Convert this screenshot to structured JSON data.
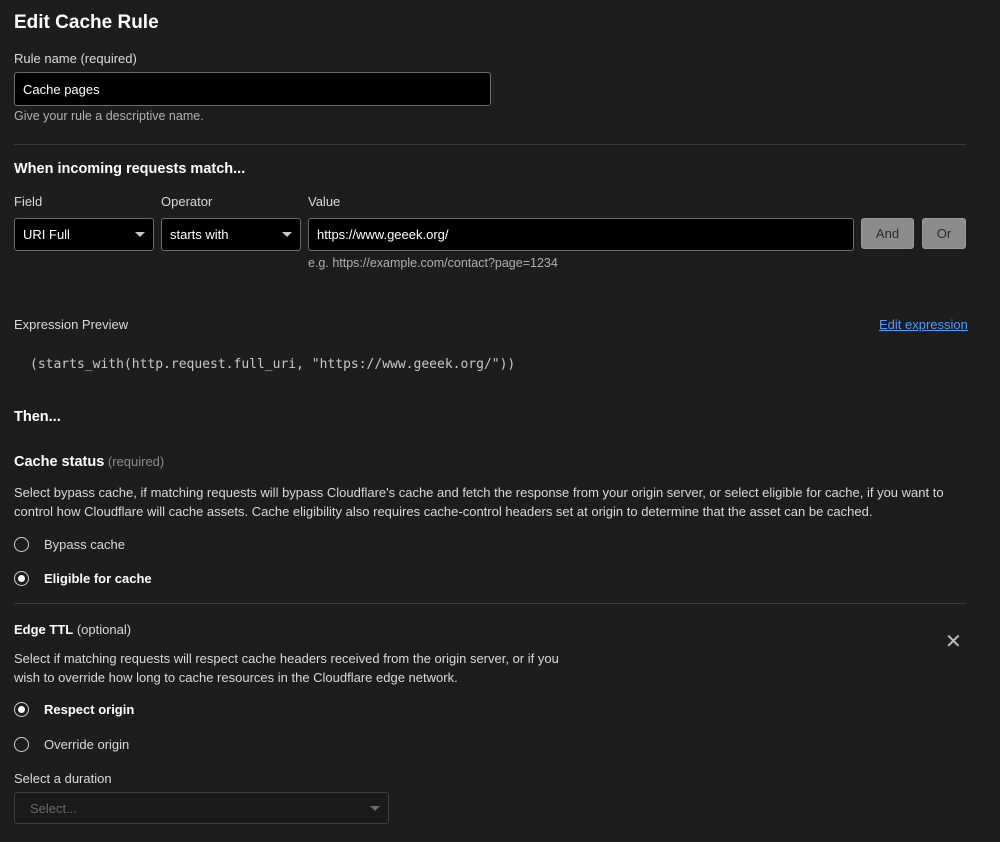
{
  "page": {
    "title": "Edit Cache Rule"
  },
  "rule_name": {
    "label": "Rule name (required)",
    "value": "Cache pages",
    "help": "Give your rule a descriptive name."
  },
  "match": {
    "heading": "When incoming requests match...",
    "field_label": "Field",
    "field_value": "URI Full",
    "operator_label": "Operator",
    "operator_value": "starts with",
    "value_label": "Value",
    "value_value": "https://www.geeek.org/",
    "value_example": "e.g. https://example.com/contact?page=1234",
    "and_label": "And",
    "or_label": "Or"
  },
  "expression": {
    "label": "Expression Preview",
    "edit_link": "Edit expression",
    "code": "(starts_with(http.request.full_uri, \"https://www.geeek.org/\"))"
  },
  "then": {
    "heading": "Then..."
  },
  "cache_status": {
    "heading": "Cache status",
    "required": "(required)",
    "description": "Select bypass cache, if matching requests will bypass Cloudflare's cache and fetch the response from your origin server, or select eligible for cache, if you want to control how Cloudflare will cache assets. Cache eligibility also requires cache-control headers set at origin to determine that the asset can be cached.",
    "options": [
      {
        "label": "Bypass cache",
        "selected": false
      },
      {
        "label": "Eligible for cache",
        "selected": true
      }
    ]
  },
  "edge_ttl": {
    "heading": "Edge TTL",
    "optional": "(optional)",
    "description": "Select if matching requests will respect cache headers received from the origin server, or if you wish to override how long to cache resources in the Cloudflare edge network.",
    "options": [
      {
        "label": "Respect origin",
        "selected": true
      },
      {
        "label": "Override origin",
        "selected": false
      }
    ],
    "duration_label": "Select a duration",
    "duration_placeholder": "Select..."
  }
}
